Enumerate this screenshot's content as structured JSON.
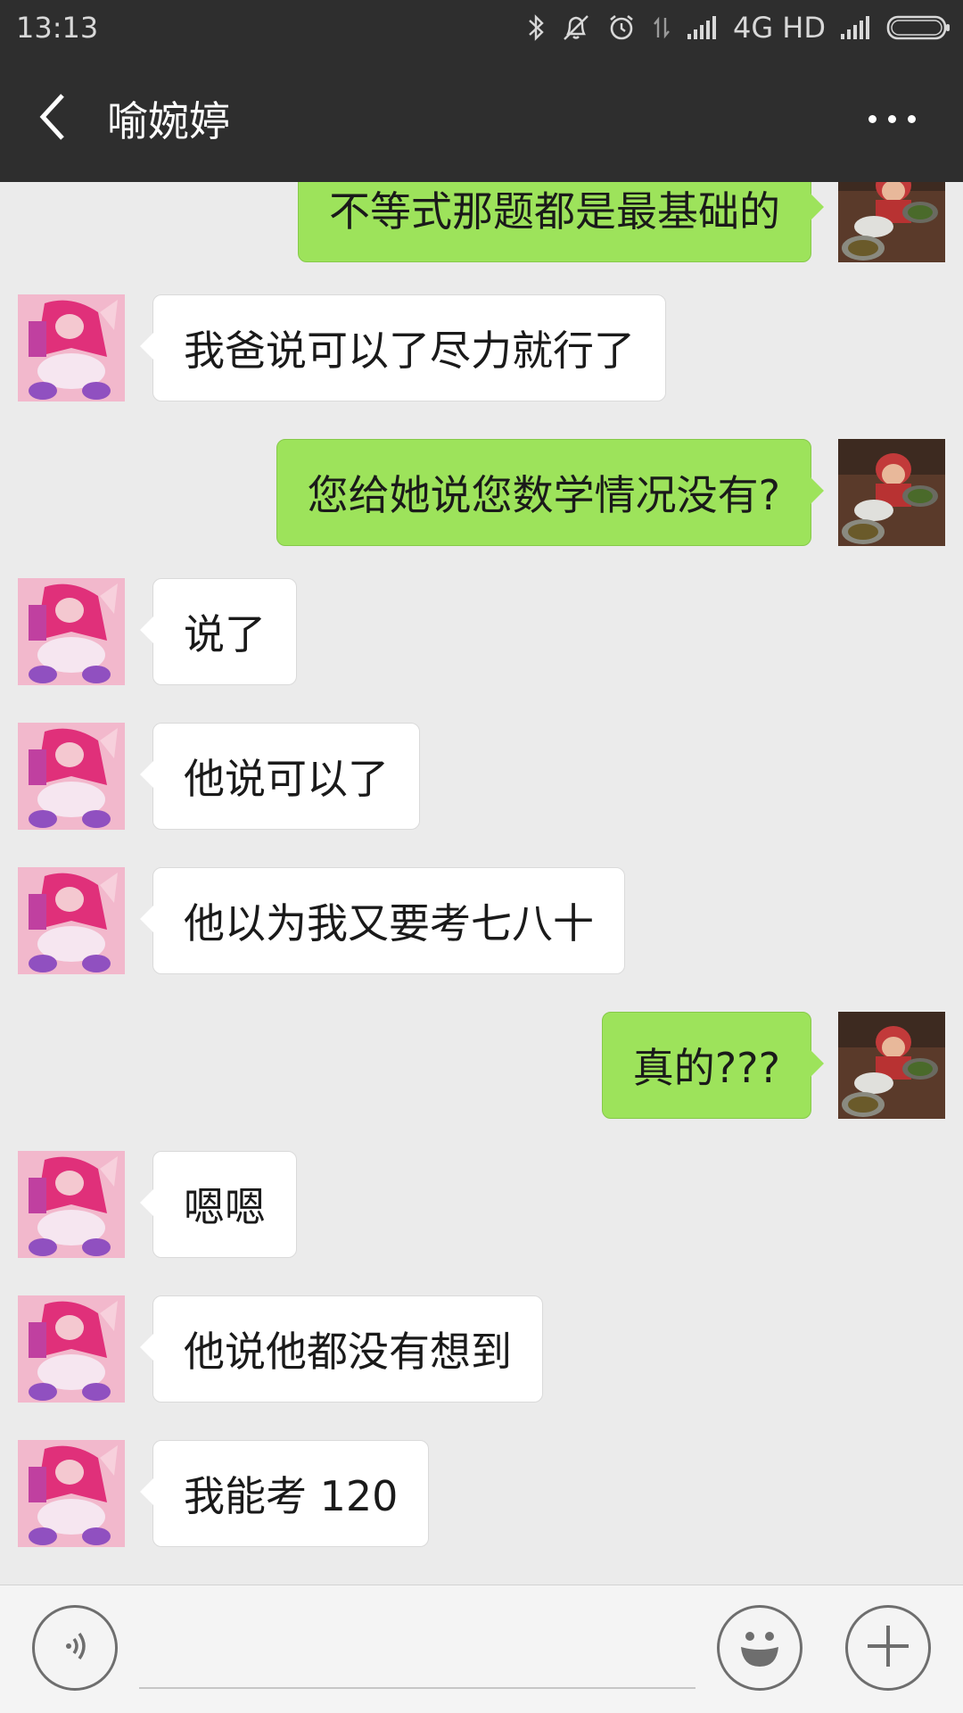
{
  "status_bar": {
    "time": "13:13",
    "network": "4G HD",
    "icons": [
      "bluetooth-icon",
      "mute-icon",
      "alarm-icon",
      "data-arrows-icon",
      "signal-icon",
      "signal-icon",
      "battery-icon"
    ]
  },
  "header": {
    "title": "喻婉婷",
    "back_icon": "chevron-left-icon",
    "more_icon": "more-dots-icon"
  },
  "messages": [
    {
      "side": "right",
      "text": "不等式那题都是最基础的"
    },
    {
      "side": "left",
      "text": "我爸说可以了尽力就行了"
    },
    {
      "side": "right",
      "text": "您给她说您数学情况没有?"
    },
    {
      "side": "left",
      "text": "说了"
    },
    {
      "side": "left",
      "text": "他说可以了"
    },
    {
      "side": "left",
      "text": "他以为我又要考七八十"
    },
    {
      "side": "right",
      "text": "真的???"
    },
    {
      "side": "left",
      "text": "嗯嗯"
    },
    {
      "side": "left",
      "text": "他说他都没有想到"
    },
    {
      "side": "left",
      "text": "我能考 120"
    }
  ],
  "input_bar": {
    "voice_icon": "voice-icon",
    "emoji_icon": "emoji-icon",
    "plus_icon": "plus-icon",
    "placeholder": ""
  },
  "colors": {
    "header_bg": "#2e2e2e",
    "chat_bg": "#ebebeb",
    "bubble_sent": "#9de35b",
    "bubble_received": "#ffffff"
  }
}
